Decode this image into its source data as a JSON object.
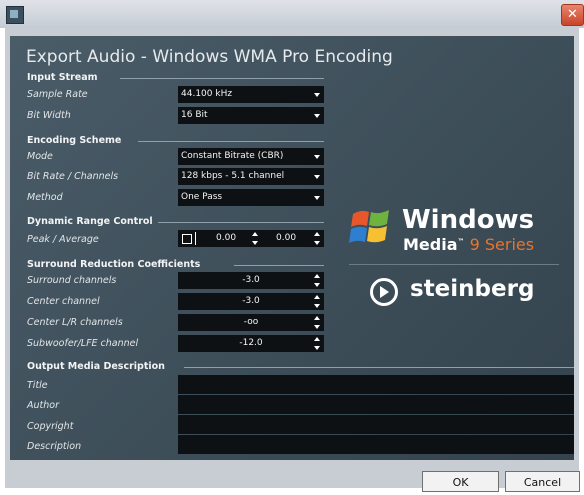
{
  "window": {
    "icon": "app-icon",
    "close_glyph": "✕"
  },
  "dialog": {
    "title": "Export Audio - Windows WMA Pro Encoding"
  },
  "input_stream": {
    "heading": "Input Stream",
    "sample_rate": {
      "label": "Sample Rate",
      "value": "44.100 kHz"
    },
    "bit_width": {
      "label": "Bit Width",
      "value": "16 Bit"
    }
  },
  "encoding_scheme": {
    "heading": "Encoding Scheme",
    "mode": {
      "label": "Mode",
      "value": "Constant Bitrate (CBR)"
    },
    "bitrate": {
      "label": "Bit Rate / Channels",
      "value": "128 kbps - 5.1 channel"
    },
    "method": {
      "label": "Method",
      "value": "One Pass"
    }
  },
  "dynamic_range": {
    "heading": "Dynamic Range Control",
    "label": "Peak / Average",
    "peak": "0.00",
    "average": "0.00"
  },
  "surround": {
    "heading": "Surround Reduction Coefficients",
    "items": [
      {
        "label": "Surround channels",
        "value": "-3.0"
      },
      {
        "label": "Center channel",
        "value": "-3.0"
      },
      {
        "label": "Center L/R channels",
        "value": "-oo"
      },
      {
        "label": "Subwoofer/LFE channel",
        "value": "-12.0"
      }
    ]
  },
  "output_media": {
    "heading": "Output Media Description",
    "fields": [
      {
        "label": "Title",
        "value": ""
      },
      {
        "label": "Author",
        "value": ""
      },
      {
        "label": "Copyright",
        "value": ""
      },
      {
        "label": "Description",
        "value": ""
      }
    ]
  },
  "logos": {
    "windows": "Windows",
    "media": "Media",
    "tm": "™",
    "series": " 9 Series",
    "steinberg": "steinberg"
  },
  "colors": {
    "series_accent": "#e8752c",
    "panel": "#3f505b"
  },
  "buttons": {
    "ok": "OK",
    "cancel": "Cancel"
  }
}
